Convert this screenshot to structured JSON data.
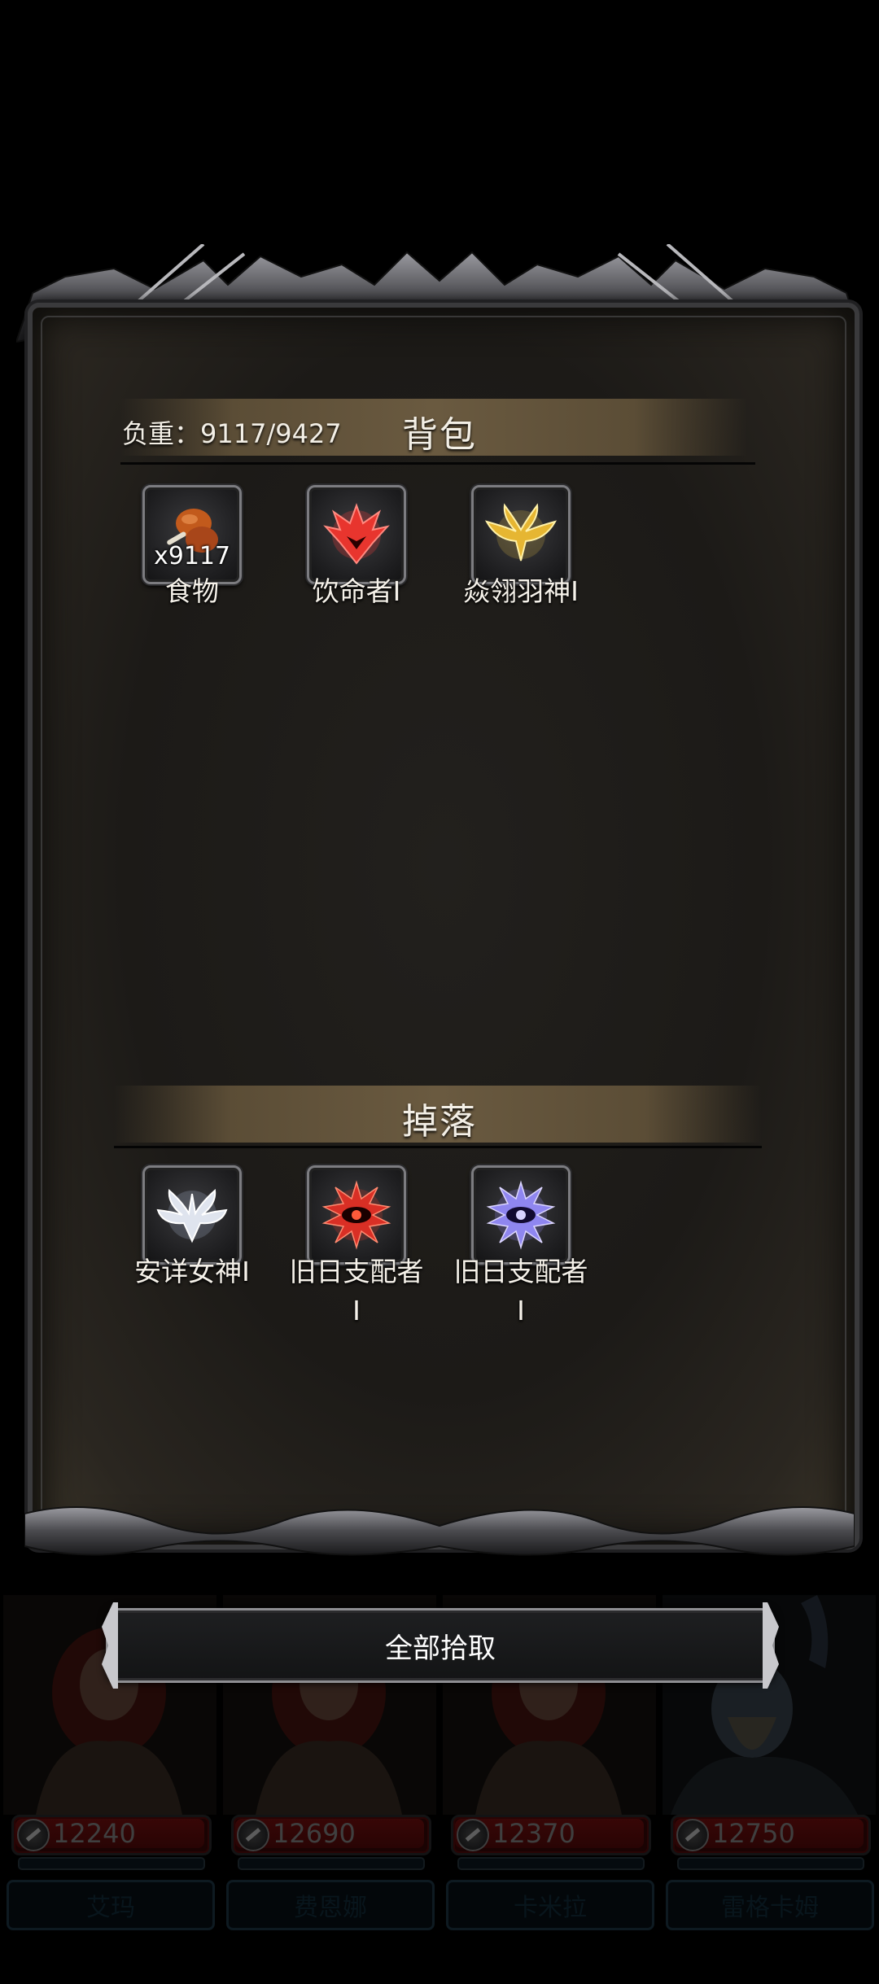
{
  "inventory": {
    "title": "背包",
    "weight_label": "负重：9117/9427",
    "items": [
      {
        "name": "食物",
        "quantity": "x9117",
        "icon": "food-drumstick-icon"
      },
      {
        "name": "饮命者Ⅰ",
        "icon": "lifedrinker-rune-icon"
      },
      {
        "name": "焱翎羽神Ⅰ",
        "icon": "golden-wings-rune-icon"
      }
    ]
  },
  "drops": {
    "title": "掉落",
    "items": [
      {
        "name": "安详女神Ⅰ",
        "icon": "serene-goddess-rune-icon"
      },
      {
        "name_line1": "旧日支配者",
        "name_line2": "Ⅰ",
        "icon": "old-ruler-red-eye-icon"
      },
      {
        "name_line1": "旧日支配者",
        "name_line2": "Ⅰ",
        "icon": "old-ruler-violet-eye-icon"
      }
    ]
  },
  "pick_all_label": "全部拾取",
  "heroes": [
    {
      "hp": "12240",
      "name": "艾玛"
    },
    {
      "hp": "12690",
      "name": "费恩娜"
    },
    {
      "hp": "12370",
      "name": "卡米拉"
    },
    {
      "hp": "12750",
      "name": "雷格卡姆"
    }
  ],
  "colors": {
    "panel_bg": "#1c1a17",
    "banner": "#6a5a40",
    "hp_red": "#7c1010",
    "frame": "#7c7c80"
  }
}
